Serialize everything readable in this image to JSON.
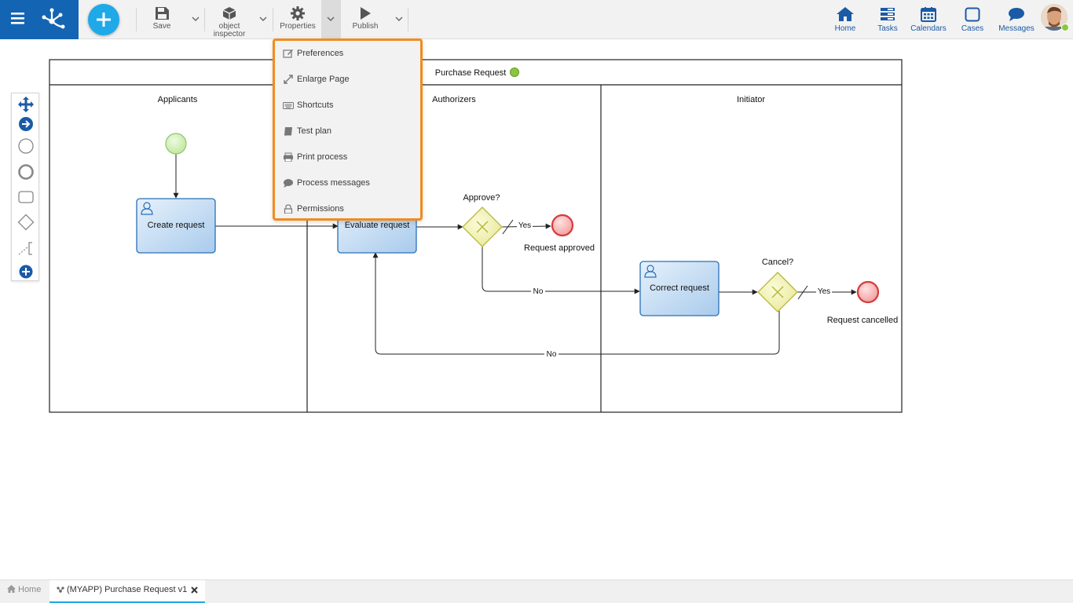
{
  "toolbar": {
    "save_label": "Save",
    "object_inspector_label_line1": "object",
    "object_inspector_label_line2": "inspector",
    "properties_label": "Properties",
    "publish_label": "Publish"
  },
  "nav": {
    "home": "Home",
    "tasks": "Tasks",
    "calendars": "Calendars",
    "cases": "Cases",
    "messages": "Messages"
  },
  "properties_menu": {
    "items": [
      {
        "label": "Preferences",
        "icon": "edit-icon"
      },
      {
        "label": "Enlarge Page",
        "icon": "expand-icon"
      },
      {
        "label": "Shortcuts",
        "icon": "keyboard-icon"
      },
      {
        "label": "Test plan",
        "icon": "book-icon"
      },
      {
        "label": "Print process",
        "icon": "printer-icon"
      },
      {
        "label": "Process messages",
        "icon": "comment-icon"
      },
      {
        "label": "Permissions",
        "icon": "lock-icon"
      }
    ]
  },
  "diagram": {
    "pool_title": "Purchase Request",
    "lanes": [
      "Applicants",
      "Authorizers",
      "Initiator"
    ],
    "tasks": {
      "create": "Create request",
      "evaluate": "Evaluate request",
      "correct": "Correct request"
    },
    "gateways": {
      "approve": "Approve?",
      "cancel": "Cancel?"
    },
    "end_events": {
      "approved": "Request approved",
      "cancelled": "Request cancelled"
    },
    "flow_labels": {
      "yes1": "Yes",
      "no1": "No",
      "yes2": "Yes",
      "no2": "No"
    },
    "colors": {
      "task_fill": "#cfe3f7",
      "task_border": "#2a6fb8",
      "gateway_fill": "#f3f3b4",
      "gateway_border": "#b8b83c",
      "start_fill": "#d9f2c0",
      "end_fill": "#f7b6b6",
      "status_dot": "#8cc63f",
      "accent": "#1464b4",
      "menu_border": "#f08c1e"
    }
  },
  "tabs": {
    "home": "Home",
    "process": "(MYAPP) Purchase Request v1"
  }
}
